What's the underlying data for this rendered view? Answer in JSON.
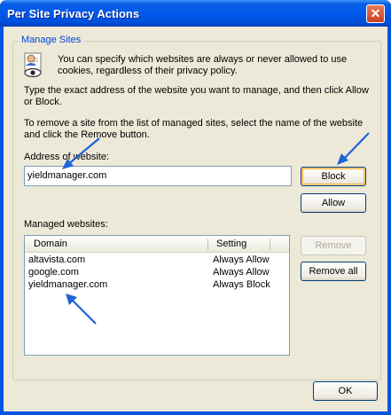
{
  "window": {
    "title": "Per Site Privacy Actions",
    "close_glyph": "✕"
  },
  "group": {
    "legend": "Manage Sites"
  },
  "intro": {
    "line1": "You can specify which websites are always or never allowed to use",
    "line2": "cookies, regardless of their privacy policy."
  },
  "instructions": {
    "type_line1": "Type the exact address of the website you want to manage, and then click Allow",
    "type_line2": "or Block.",
    "remove_line1": "To remove a site from the list of managed sites, select the name of the website",
    "remove_line2": "and click the Remove button."
  },
  "address": {
    "label": "Address of website:",
    "value": "yieldmanager.com"
  },
  "buttons": {
    "block": "Block",
    "allow": "Allow",
    "remove": "Remove",
    "remove_all": "Remove all",
    "ok": "OK"
  },
  "managed": {
    "label": "Managed websites:",
    "columns": [
      "Domain",
      "Setting"
    ],
    "rows": [
      {
        "domain": "altavista.com",
        "setting": "Always Allow"
      },
      {
        "domain": "google.com",
        "setting": "Always Allow"
      },
      {
        "domain": "yieldmanager.com",
        "setting": "Always Block"
      }
    ]
  },
  "colors": {
    "titlebar": "#0058ee",
    "dialog_bg": "#ece9d8",
    "annotation_arrow": "#1f63d9",
    "legend_text": "#0046d5"
  },
  "icons": {
    "privacy": "privacy-document-eye-icon",
    "close": "close-icon",
    "arrow": "annotation-arrow-icon"
  }
}
